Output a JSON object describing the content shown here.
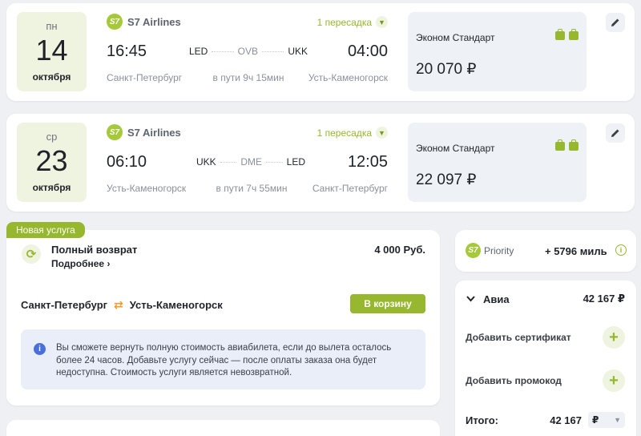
{
  "flights": [
    {
      "day_of_week": "пн",
      "day": "14",
      "month": "октября",
      "airline": "S7 Airlines",
      "logo_text": "S7",
      "transfers": "1 пересадка",
      "dep_time": "16:45",
      "arr_time": "04:00",
      "dep_city": "Санкт-Петербург",
      "arr_city": "Усть-Каменогорск",
      "from_code": "LED",
      "via_code": "OVB",
      "to_code": "UKK",
      "duration": "в пути 9ч 15мин",
      "fare": "Эконом Стандарт",
      "price": "20 070 ₽"
    },
    {
      "day_of_week": "ср",
      "day": "23",
      "month": "октября",
      "airline": "S7 Airlines",
      "logo_text": "S7",
      "transfers": "1 пересадка",
      "dep_time": "06:10",
      "arr_time": "12:05",
      "dep_city": "Усть-Каменогорск",
      "arr_city": "Санкт-Петербург",
      "from_code": "UKK",
      "via_code": "DME",
      "to_code": "LED",
      "duration": "в пути 7ч 55мин",
      "fare": "Эконом Стандарт",
      "price": "22 097 ₽"
    }
  ],
  "service": {
    "badge": "Новая услуга",
    "title": "Полный возврат",
    "more": "Подробнее",
    "price": "4 000 Руб.",
    "from": "Санкт-Петербург",
    "to": "Усть-Каменогорск",
    "cart_button": "В корзину",
    "info": "Вы сможете вернуть полную стоимость авиабилета, если до вылета осталось более 24 часов. Добавьте услугу сейчас — после оплаты заказа она будет недоступна. Стоимость услуги является невозвратной."
  },
  "priority": {
    "logo_text": "S7",
    "name": "Priority",
    "miles": "+ 5796 миль"
  },
  "summary": {
    "avia_label": "Авиа",
    "avia_total": "42 167 ₽",
    "add_certificate": "Добавить сертификат",
    "add_promo": "Добавить промокод",
    "total_label": "Итого:",
    "total_value": "42 167",
    "currency": "₽"
  },
  "colors": {
    "brand_green": "#97b72e",
    "accent_orange": "#f29a2e",
    "info_blue": "#4a6fd8"
  }
}
